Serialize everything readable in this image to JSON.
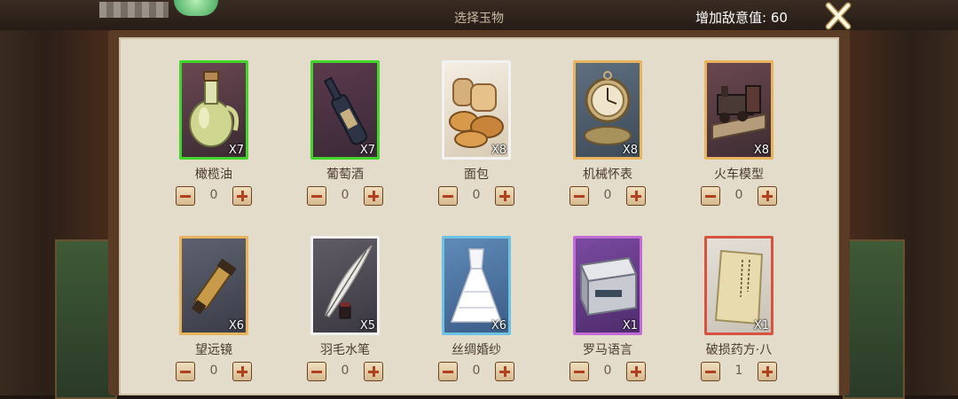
{
  "header": {
    "title": "选择玉物",
    "hostility_label": "增加敌意值:",
    "hostility_value": "60"
  },
  "colors": {
    "rarity_green": "#44d22c",
    "rarity_white": "#f2f2f2",
    "rarity_gold": "#e7b35c",
    "rarity_blue": "#6cc3e3",
    "rarity_purple": "#c26bd6",
    "rarity_red": "#d8533f"
  },
  "items": [
    {
      "name": "橄榄油",
      "count": "X7",
      "qty": "0",
      "rarity": "green",
      "icon": "olive-oil-bottle-icon"
    },
    {
      "name": "葡萄酒",
      "count": "X7",
      "qty": "0",
      "rarity": "green",
      "icon": "wine-bottle-icon"
    },
    {
      "name": "面包",
      "count": "X8",
      "qty": "0",
      "rarity": "white",
      "icon": "bread-icon"
    },
    {
      "name": "机械怀表",
      "count": "X8",
      "qty": "0",
      "rarity": "gold",
      "icon": "pocket-watch-icon"
    },
    {
      "name": "火车模型",
      "count": "X8",
      "qty": "0",
      "rarity": "gold",
      "icon": "train-model-icon"
    },
    {
      "name": "望远镜",
      "count": "X6",
      "qty": "0",
      "rarity": "gold",
      "icon": "telescope-icon"
    },
    {
      "name": "羽毛水笔",
      "count": "X5",
      "qty": "0",
      "rarity": "white",
      "icon": "quill-pen-icon"
    },
    {
      "name": "丝绸婚纱",
      "count": "X6",
      "qty": "0",
      "rarity": "blue",
      "icon": "wedding-dress-icon"
    },
    {
      "name": "罗马语言",
      "count": "X1",
      "qty": "0",
      "rarity": "purple",
      "icon": "book-icon"
    },
    {
      "name": "破损药方·八",
      "count": "X1",
      "qty": "1",
      "rarity": "red",
      "icon": "recipe-scroll-icon"
    }
  ]
}
